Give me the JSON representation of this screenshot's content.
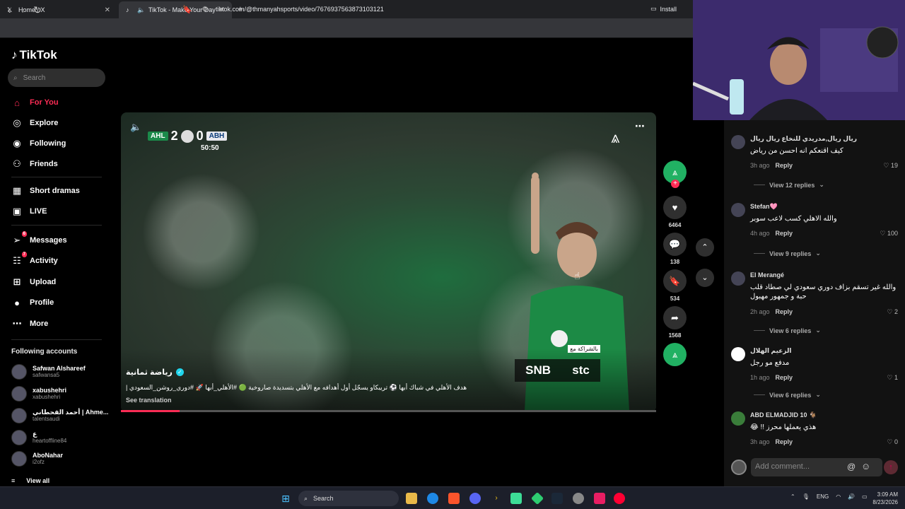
{
  "browser": {
    "tabs": [
      {
        "title": "Home / X",
        "icon": "x-logo-icon"
      },
      {
        "title": "TikTok - Make Your Day",
        "icon": "tiktok-icon"
      }
    ],
    "url": "tiktok.com/@thmanyahsports/video/7676937563873103121",
    "install_label": "Install"
  },
  "sidebar": {
    "logo": "TikTok",
    "search_placeholder": "Search",
    "nav": [
      {
        "label": "For You",
        "icon": "home-icon",
        "active": true
      },
      {
        "label": "Explore",
        "icon": "compass-icon"
      },
      {
        "label": "Following",
        "icon": "following-avatar-icon"
      },
      {
        "label": "Friends",
        "icon": "friends-icon"
      },
      {
        "label": "Short dramas",
        "icon": "film-icon"
      },
      {
        "label": "LIVE",
        "icon": "live-tv-icon"
      },
      {
        "label": "Messages",
        "icon": "paper-plane-icon",
        "badge": "6"
      },
      {
        "label": "Activity",
        "icon": "activity-icon",
        "badge": "7"
      },
      {
        "label": "Upload",
        "icon": "plus-square-icon"
      },
      {
        "label": "Profile",
        "icon": "profile-avatar-icon"
      },
      {
        "label": "More",
        "icon": "ellipsis-icon"
      }
    ],
    "following_title": "Following accounts",
    "accounts": [
      {
        "name": "Safwan Alshareef",
        "handle": "safwansa5"
      },
      {
        "name": "xabushehri",
        "handle": "xabushehri"
      },
      {
        "name": "أحمد القحطاني | Ahme...",
        "handle": "talentsaudi"
      },
      {
        "name": "ع",
        "handle": "heartoffline84"
      },
      {
        "name": "AboNahar",
        "handle": "i2ofz"
      }
    ],
    "view_all": "View all"
  },
  "video": {
    "team_home": "AHL",
    "score_home": "2",
    "score_away": "0",
    "team_away": "ABH",
    "clock": "50:50",
    "sponsor_tag": "بالشراكة مع",
    "sponsor_a": "SNB",
    "sponsor_b": "stc",
    "author": "رياضة ثمانية",
    "description": "هدف الأهلي في شباك أبها ⚽️ تريبكاو يسجّل أول أهدافه مع الأهلي بتسديدة صاروخية 🟢 #الأهلي_أبها 🚀 #دوري_روشن_السعودي |",
    "see_translation": "See translation",
    "progress": 0.11
  },
  "actions": {
    "likes": "6464",
    "comments": "138",
    "saves": "534",
    "shares": "1568"
  },
  "comments": [
    {
      "name": "ريال ريال,مدريدي للنخاع ريال ريال",
      "text": "كيف اقنعكم انه احسن من رياض",
      "time": "3h ago",
      "reply": "Reply",
      "likes": "19",
      "replies": "View 12 replies"
    },
    {
      "name": "Stefan🩷",
      "text": "والله الاهلي كسب لاعب سوبر",
      "time": "4h ago",
      "reply": "Reply",
      "likes": "100",
      "replies": "View 9 replies"
    },
    {
      "name": "El Merangé",
      "text": "والله غير تسقم بزاف دوري سعودي لي صطاد قلب حبة و جمهور مهبول",
      "time": "2h ago",
      "reply": "Reply",
      "likes": "2",
      "replies": "View 6 replies"
    },
    {
      "name": "الزعيم الهلال",
      "text": "مدفع مو رجل",
      "time": "1h ago",
      "reply": "Reply",
      "likes": "1",
      "replies": "View 6 replies"
    },
    {
      "name": "ABD ELMADJID 10 🐐",
      "text": "هذي يعملها محرز !! 😂",
      "time": "3h ago",
      "reply": "Reply",
      "likes": "0",
      "replies": ""
    }
  ],
  "add_comment_placeholder": "Add comment...",
  "taskbar": {
    "search": "Search",
    "lang": "ENG",
    "time": "3:09 AM",
    "date": "8/23/2026"
  },
  "colors": {
    "accent": "#fe2c55",
    "green": "#21b163"
  }
}
